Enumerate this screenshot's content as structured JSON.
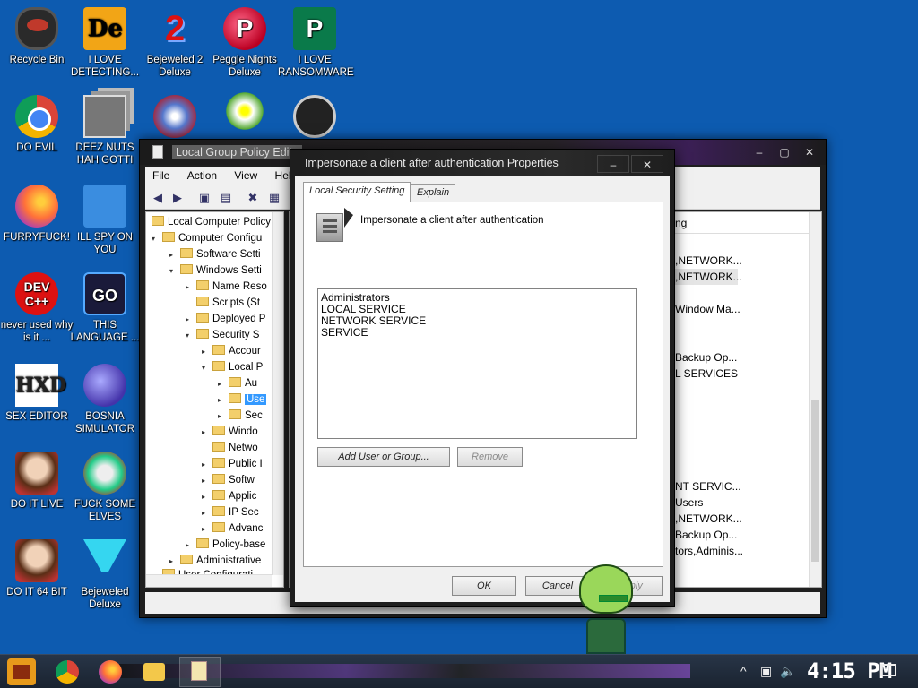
{
  "desktop_icons": [
    {
      "label": "Recycle Bin",
      "icon": "recycle-bin-icon"
    },
    {
      "label": "I LOVE DETECTING...",
      "icon": "de-app-icon"
    },
    {
      "label": "Bejeweled 2 Deluxe",
      "icon": "bejeweled-2-icon"
    },
    {
      "label": "Peggle Nights Deluxe",
      "icon": "peggle-icon"
    },
    {
      "label": "I LOVE RANSOMWARE",
      "icon": "publisher-icon"
    },
    {
      "label": "DO EVIL",
      "icon": "chrome-icon"
    },
    {
      "label": "DEEZ NUTS HAH GOTTI",
      "icon": "stacked-windows-icon"
    },
    {
      "label": "",
      "icon": "gem-icon"
    },
    {
      "label": "",
      "icon": "flower-icon"
    },
    {
      "label": "",
      "icon": "dragon-icon"
    },
    {
      "label": "FURRYFUCK!",
      "icon": "firefox-icon"
    },
    {
      "label": "ILL SPY ON YOU",
      "icon": "spy-icon"
    },
    {
      "label": "never used why is it ...",
      "icon": "dev-cpp-icon"
    },
    {
      "label": "THIS LANGUAGE ...",
      "icon": "go-icon"
    },
    {
      "label": "SEX EDITOR",
      "icon": "hxd-icon"
    },
    {
      "label": "BOSNIA SIMULATOR",
      "icon": "minesweeper-icon"
    },
    {
      "label": "DO IT LIVE",
      "icon": "portrait-icon"
    },
    {
      "label": "FUCK SOME ELVES",
      "icon": "elf-icon"
    },
    {
      "label": "DO IT 64 BIT",
      "icon": "portrait-64-icon"
    },
    {
      "label": "Bejeweled Deluxe",
      "icon": "diamond-icon"
    }
  ],
  "gp_window": {
    "title": "Local Group Policy Edito",
    "menu": [
      "File",
      "Action",
      "View",
      "Help"
    ],
    "tree": [
      {
        "label": "Local Computer Policy",
        "arrow": ""
      },
      {
        "label": "Computer Configu",
        "arrow": "▾"
      },
      {
        "label": "Software Setti",
        "arrow": "▸"
      },
      {
        "label": "Windows Setti",
        "arrow": "▾"
      },
      {
        "label": "Name Reso",
        "arrow": "▸"
      },
      {
        "label": "Scripts (St",
        "arrow": ""
      },
      {
        "label": "Deployed P",
        "arrow": "▸"
      },
      {
        "label": "Security S",
        "arrow": "▾"
      },
      {
        "label": "Accour",
        "arrow": "▸"
      },
      {
        "label": "Local P",
        "arrow": "▾"
      },
      {
        "label": "Au",
        "arrow": "▸"
      },
      {
        "label": "Use",
        "arrow": "▸"
      },
      {
        "label": "Sec",
        "arrow": "▸"
      },
      {
        "label": "Windo",
        "arrow": "▸"
      },
      {
        "label": "Netwo",
        "arrow": ""
      },
      {
        "label": "Public I",
        "arrow": "▸"
      },
      {
        "label": "Softw",
        "arrow": "▸"
      },
      {
        "label": "Applic",
        "arrow": "▸"
      },
      {
        "label": "IP Sec",
        "arrow": "▸"
      },
      {
        "label": "Advanc",
        "arrow": "▸"
      },
      {
        "label": "Policy-base",
        "arrow": "▸"
      },
      {
        "label": "Administrative",
        "arrow": "▸"
      },
      {
        "label": "User Configurati",
        "arrow": "▸"
      }
    ],
    "list_header": "ng",
    "list_rows": [
      ",NETWORK...",
      ",NETWORK...",
      "Window Ma...",
      "Backup Op...",
      "L SERVICES",
      "NT SERVIC...",
      "Users",
      ",NETWORK...",
      "Backup Op...",
      "tors,Adminis..."
    ]
  },
  "dialog": {
    "title": "Impersonate a client after authentication Properties",
    "minimize": "–",
    "close": "✕",
    "tabs": [
      "Local Security Setting",
      "Explain"
    ],
    "policy_name": "Impersonate a client after authentication",
    "members": [
      "Administrators",
      "LOCAL SERVICE",
      "NETWORK SERVICE",
      "SERVICE"
    ],
    "add_button": "Add User or Group...",
    "remove_button": "Remove",
    "ok_button": "OK",
    "cancel_button": "Cancel",
    "apply_button": "Apply"
  },
  "taskbar": {
    "clock": "4:15 PM"
  }
}
